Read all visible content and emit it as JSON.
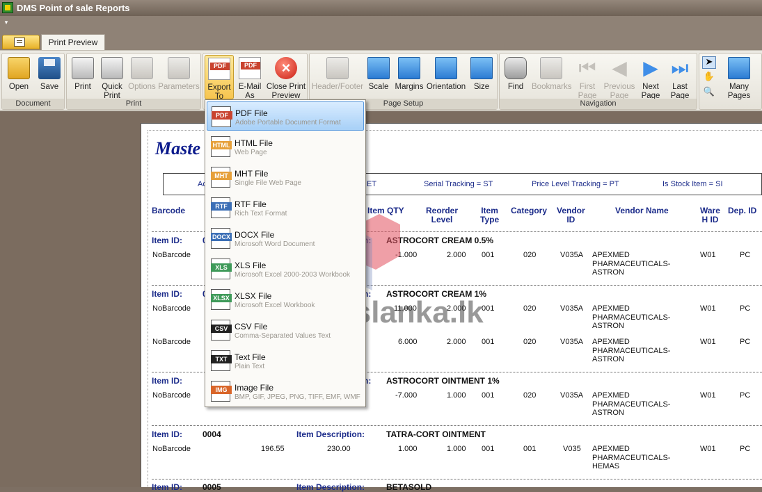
{
  "window": {
    "title": "DMS Point of sale Reports"
  },
  "tabs": {
    "active": "Print Preview"
  },
  "ribbon": {
    "groups": {
      "document": "Document",
      "print": "Print",
      "page_setup": "Page Setup",
      "navigation": "Navigation"
    },
    "buttons": {
      "open": "Open",
      "save": "Save",
      "print": "Print",
      "quick_print_1": "Quick",
      "quick_print_2": "Print",
      "options": "Options",
      "parameters": "Parameters",
      "export_1": "Export",
      "export_2": "To",
      "email_1": "E-Mail",
      "email_2": "As",
      "close_1": "Close Print",
      "close_2": "Preview",
      "header_footer": "Header/Footer",
      "scale": "Scale",
      "margins": "Margins",
      "orientation": "Orientation",
      "size": "Size",
      "find": "Find",
      "bookmarks": "Bookmarks",
      "first_page_1": "First",
      "first_page_2": "Page",
      "previous_page_1": "Previous",
      "previous_page_2": "Page",
      "next_page_1": "Next",
      "next_page_2": "Page",
      "last_page_1": "Last",
      "last_page_2": "Page",
      "many_pages": "Many Pages"
    }
  },
  "export_menu": {
    "items": [
      {
        "title": "PDF File",
        "subtitle": "Adobe Portable Document Format",
        "tag": "PDF",
        "color": "#c9432f"
      },
      {
        "title": "HTML File",
        "subtitle": "Web Page",
        "tag": "HTML",
        "color": "#e6a03a"
      },
      {
        "title": "MHT File",
        "subtitle": "Single File Web Page",
        "tag": "MHT",
        "color": "#e6a03a"
      },
      {
        "title": "RTF File",
        "subtitle": "Rich Text Format",
        "tag": "RTF",
        "color": "#3c6fb6"
      },
      {
        "title": "DOCX File",
        "subtitle": "Microsoft Word Document",
        "tag": "DOCX",
        "color": "#3c6fb6"
      },
      {
        "title": "XLS File",
        "subtitle": "Microsoft Excel 2000-2003 Workbook",
        "tag": "XLS",
        "color": "#3f9a5a"
      },
      {
        "title": "XLSX File",
        "subtitle": "Microsoft Excel Workbook",
        "tag": "XLSX",
        "color": "#3f9a5a"
      },
      {
        "title": "CSV File",
        "subtitle": "Comma-Separated Values Text",
        "tag": "CSV",
        "color": "#222222"
      },
      {
        "title": "Text File",
        "subtitle": "Plain Text",
        "tag": "TXT",
        "color": "#222222"
      },
      {
        "title": "Image File",
        "subtitle": "BMP, GIF, JPEG, PNG, TIFF, EMF, WMF",
        "tag": "IMG",
        "color": "#d9662a"
      }
    ]
  },
  "report": {
    "title_visible": "Maste",
    "legend": {
      "a": "Ac",
      "b": "ET",
      "serial": "Serial Tracking = ST",
      "price": "Price Level Tracking = PT",
      "stock": "Is Stock Item = SI"
    },
    "columns": {
      "barcode": "Barcode",
      "item_qty": "Item QTY",
      "reorder_1": "Reorder",
      "reorder_2": "Level",
      "item_type_1": "Item",
      "item_type_2": "Type",
      "category": "Category",
      "vendor_id_1": "Vendor",
      "vendor_id_2": "ID",
      "vendor_name": "Vendor Name",
      "wareh_1": "Ware",
      "wareh_2": "H ID",
      "dep_id": "Dep. ID"
    },
    "item_id_label": "Item ID:",
    "item_desc_label": "Item Description:",
    "desc_colon": "n:",
    "lead_digit": "0",
    "groups": [
      {
        "desc": "ASTROCORT CREAM 0.5%",
        "rows": [
          {
            "barcode": "NoBarcode",
            "qty": "-1.000",
            "reorder": "2.000",
            "type": "001",
            "cat": "020",
            "vid": "V035A",
            "vname": [
              "APEXMED",
              "PHARMACEUTICALS-",
              "ASTRON"
            ],
            "wh": "W01",
            "dep": "PC"
          }
        ]
      },
      {
        "desc": "ASTROCORT CREAM 1%",
        "rows": [
          {
            "barcode": "NoBarcode",
            "qty": "11.000",
            "reorder": "2.000",
            "type": "001",
            "cat": "020",
            "vid": "V035A",
            "vname": [
              "APEXMED",
              "PHARMACEUTICALS-",
              "ASTRON"
            ],
            "wh": "W01",
            "dep": "PC"
          },
          {
            "barcode": "NoBarcode",
            "qty": "6.000",
            "reorder": "2.000",
            "type": "001",
            "cat": "020",
            "vid": "V035A",
            "vname": [
              "APEXMED",
              "PHARMACEUTICALS-",
              "ASTRON"
            ],
            "wh": "W01",
            "dep": "PC"
          }
        ]
      },
      {
        "desc": "ASTROCORT OINTMENT 1%",
        "rows": [
          {
            "barcode": "NoBarcode",
            "qty": "-7.000",
            "reorder": "1.000",
            "type": "001",
            "cat": "020",
            "vid": "V035A",
            "vname": [
              "APEXMED",
              "PHARMACEUTICALS-",
              "ASTRON"
            ],
            "wh": "W01",
            "dep": "PC"
          }
        ]
      },
      {
        "id": "0004",
        "desc": "TATRA-CORT OINTMENT",
        "rows": [
          {
            "barcode": "NoBarcode",
            "cost": "196.55",
            "price": "230.00",
            "qty": "1.000",
            "reorder": "1.000",
            "type": "001",
            "cat": "001",
            "vid": "V035",
            "vname": [
              "APEXMED",
              "PHARMACEUTICALS-",
              "HEMAS"
            ],
            "wh": "W01",
            "dep": "PC"
          }
        ]
      }
    ],
    "partial_next": {
      "id": "0005",
      "desc": "BETASOLD"
    }
  },
  "watermark": "poslanka.lk"
}
